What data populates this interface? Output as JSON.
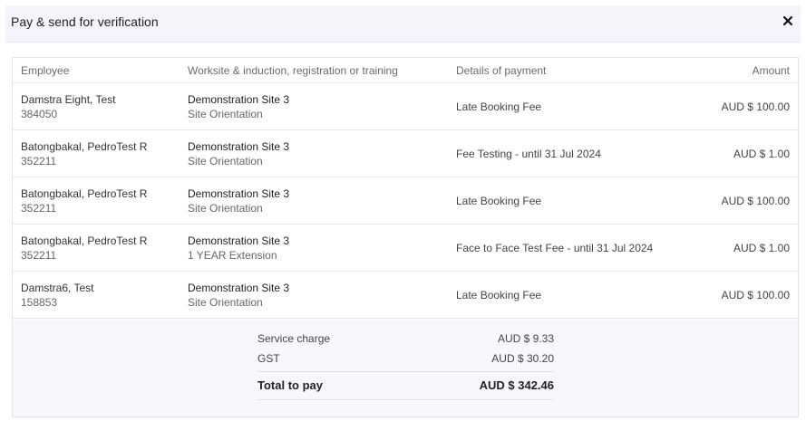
{
  "modal": {
    "title": "Pay & send for verification",
    "close_icon": "close-icon"
  },
  "table": {
    "headers": {
      "employee": "Employee",
      "worksite": "Worksite & induction, registration or training",
      "details": "Details of payment",
      "amount": "Amount"
    },
    "rows": [
      {
        "employee_name": "Damstra Eight, Test",
        "employee_id": "384050",
        "site": "Demonstration Site 3",
        "induction": "Site Orientation",
        "details": "Late Booking Fee",
        "amount": "AUD $ 100.00"
      },
      {
        "employee_name": "Batongbakal, PedroTest R",
        "employee_id": "352211",
        "site": "Demonstration Site 3",
        "induction": "Site Orientation",
        "details": "Fee Testing - until 31 Jul 2024",
        "amount": "AUD $ 1.00"
      },
      {
        "employee_name": "Batongbakal, PedroTest R",
        "employee_id": "352211",
        "site": "Demonstration Site 3",
        "induction": "Site Orientation",
        "details": "Late Booking Fee",
        "amount": "AUD $ 100.00"
      },
      {
        "employee_name": "Batongbakal, PedroTest R",
        "employee_id": "352211",
        "site": "Demonstration Site 3",
        "induction": "1 YEAR Extension",
        "details": "Face to Face Test Fee - until 31 Jul 2024",
        "amount": "AUD $ 1.00"
      },
      {
        "employee_name": "Damstra6, Test",
        "employee_id": "158853",
        "site": "Demonstration Site 3",
        "induction": "Site Orientation",
        "details": "Late Booking Fee",
        "amount": "AUD $ 100.00"
      }
    ]
  },
  "summary": {
    "service_charge_label": "Service charge",
    "service_charge_value": "AUD $ 9.33",
    "gst_label": "GST",
    "gst_value": "AUD $ 30.20",
    "total_label": "Total to pay",
    "total_value": "AUD $ 342.46"
  }
}
